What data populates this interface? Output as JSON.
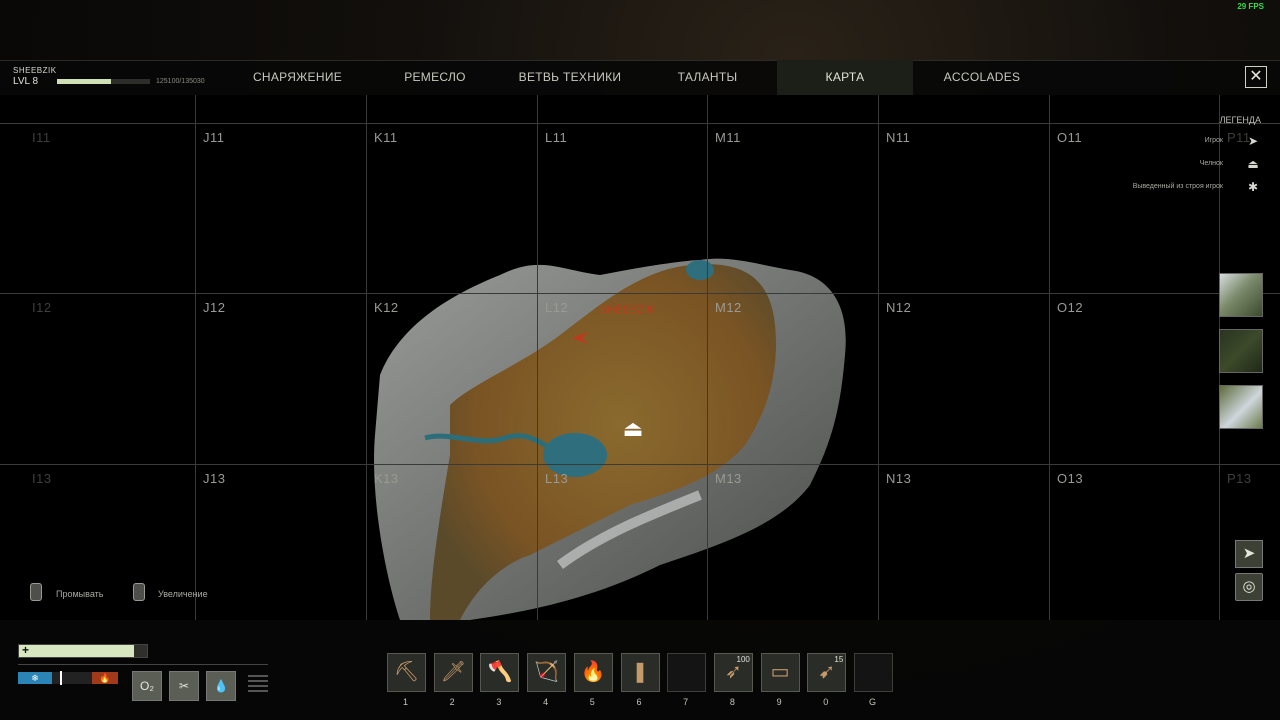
{
  "fps": "29 FPS",
  "player": {
    "name": "SHEEBZIK",
    "level": "LVL 8",
    "xp": "125100/135030",
    "xp_progress": 0.58
  },
  "tabs": [
    {
      "label": "СНАРЯЖЕНИЕ"
    },
    {
      "label": "РЕМЕСЛО"
    },
    {
      "label": "ВЕТВЬ ТЕХНИКИ"
    },
    {
      "label": "ТАЛАНТЫ"
    },
    {
      "label": "КАРТА",
      "active": true
    },
    {
      "label": "ACCOLADES"
    }
  ],
  "close_label": "✕",
  "grid": {
    "row11": [
      "I11",
      "J11",
      "K11",
      "L11",
      "M11",
      "N11",
      "O11",
      "P11"
    ],
    "row12": [
      "I12",
      "J12",
      "K12",
      "L12",
      "M12",
      "N12",
      "O12"
    ],
    "row13": [
      "I13",
      "J13",
      "K13",
      "L13",
      "M13",
      "N13",
      "O13",
      "P13"
    ]
  },
  "map_marker_label": "SHEEBZIK",
  "legend": {
    "title": "ЛЕГЕНДА",
    "items": [
      {
        "label": "Игрок",
        "icon": "arrow-icon"
      },
      {
        "label": "Челнок",
        "icon": "dropship-icon"
      },
      {
        "label": "Выведенный из строя игрок",
        "icon": "downed-player-icon"
      }
    ]
  },
  "hints": {
    "pan": "Промывать",
    "zoom": "Увеличение"
  },
  "vitals": {
    "health_fraction": 0.9,
    "oxygen_label": "O₂"
  },
  "hotbar": [
    {
      "num": "1",
      "icon": "pickaxe-icon",
      "glyph": "⛏"
    },
    {
      "num": "2",
      "icon": "knife-icon",
      "glyph": "🗡"
    },
    {
      "num": "3",
      "icon": "axe-icon",
      "glyph": "🪓"
    },
    {
      "num": "4",
      "icon": "bow-icon",
      "glyph": "🏹"
    },
    {
      "num": "5",
      "icon": "torch-icon",
      "glyph": "🔥"
    },
    {
      "num": "6",
      "icon": "club-icon",
      "glyph": "❚"
    },
    {
      "num": "7",
      "icon": "empty-slot",
      "glyph": ""
    },
    {
      "num": "8",
      "icon": "arrows-icon",
      "glyph": "➶",
      "qty": "100"
    },
    {
      "num": "9",
      "icon": "bandage-icon",
      "glyph": "▭"
    },
    {
      "num": "0",
      "icon": "spear-icon",
      "glyph": "➹",
      "qty": "15"
    },
    {
      "num": "G",
      "icon": "empty-slot",
      "glyph": ""
    }
  ]
}
